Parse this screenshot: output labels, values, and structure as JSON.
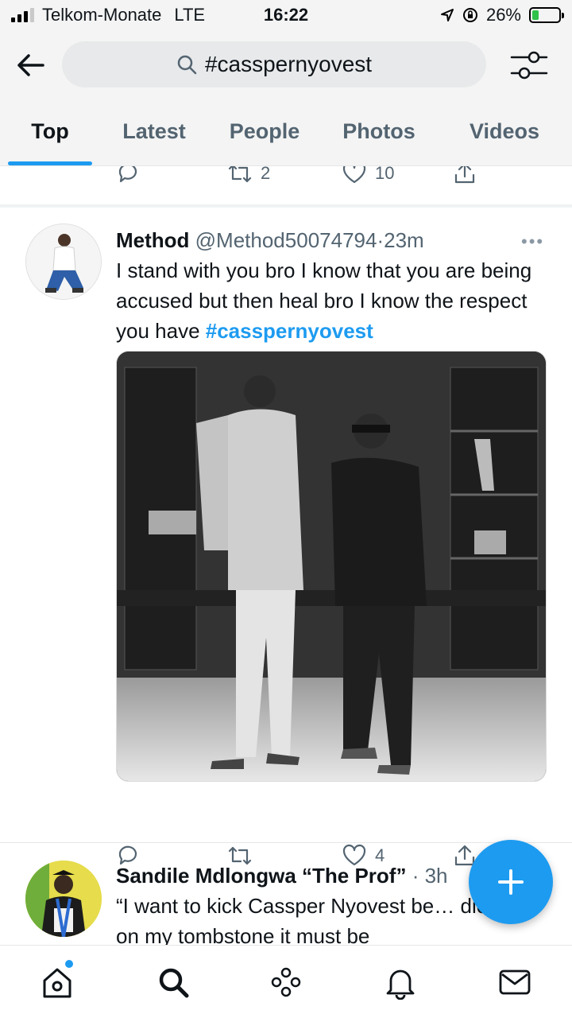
{
  "status_bar": {
    "carrier": "Telkom-Monate",
    "network": "LTE",
    "time": "16:22",
    "battery": "26%",
    "battery_level": 0.26
  },
  "header": {
    "search_text": "#casspernyovest",
    "tabs": [
      "Top",
      "Latest",
      "People",
      "Photos",
      "Videos"
    ],
    "active_tab": "Top"
  },
  "prev_tweet": {
    "retweets": "2",
    "likes": "10"
  },
  "tweet1": {
    "name": "Method",
    "handle": "@Method50074794",
    "dot": "·",
    "time": "23m",
    "text": "I stand with you bro I know that you are being accused but then heal bro I know the respect you have ",
    "hashtag": "#casspernyovest",
    "likes": "4"
  },
  "tweet2": {
    "name": "Sandile Mdlongwa “The Prof”",
    "meta": "· 3h",
    "text": "“I want to kick Cassper Nyovest be… die. And on my tombstone it must be"
  },
  "colors": {
    "accent": "#1d9bf0",
    "text": "#0f1419",
    "muted": "#536471"
  },
  "icons": [
    "back-arrow-icon",
    "search-icon",
    "filter-icon",
    "reply-icon",
    "retweet-icon",
    "like-icon",
    "share-icon",
    "more-icon",
    "compose-icon",
    "home-icon",
    "explore-icon",
    "spaces-icon",
    "notifications-icon",
    "messages-icon"
  ]
}
